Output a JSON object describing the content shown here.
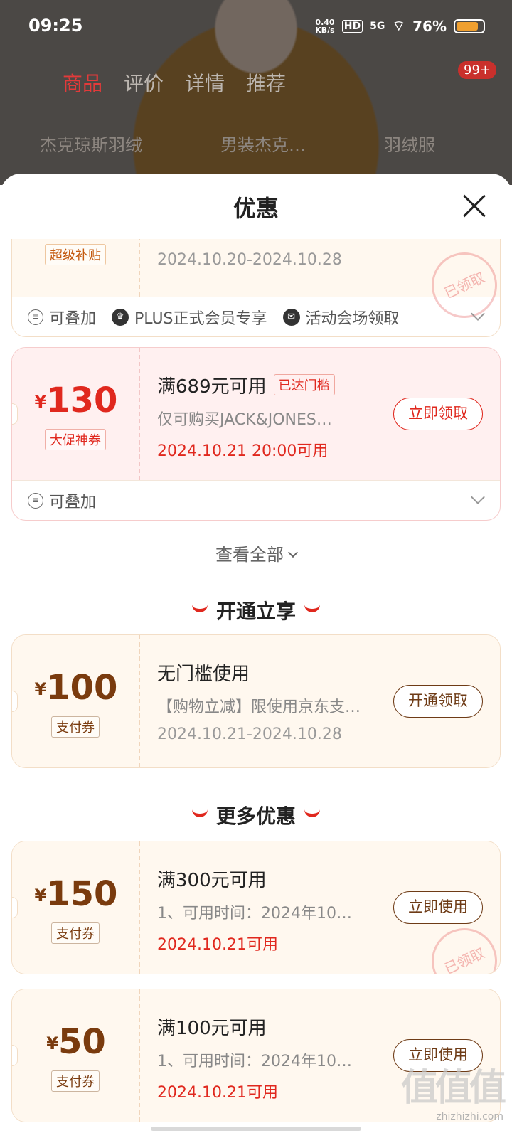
{
  "status_bar": {
    "time": "09:25",
    "net_speed_value": "0.40",
    "net_speed_unit": "KB/s",
    "hd": "HD",
    "signal": "5G",
    "battery": "76%"
  },
  "background_page": {
    "tabs": [
      "商品",
      "评价",
      "详情",
      "推荐"
    ],
    "badge": "99+",
    "search_placeholder": "杰克琼斯羽绒",
    "search_chips": [
      "男装杰克…",
      "羽绒服"
    ]
  },
  "sheet": {
    "title": "优惠",
    "cards_top": [
      {
        "tag": "超级补贴",
        "date": "2024.10.20-2024.10.28",
        "stamp": "已领取",
        "footer": {
          "items": [
            "可叠加",
            "PLUS正式会员专享",
            "活动会场领取"
          ]
        }
      },
      {
        "currency": "¥",
        "amount": "130",
        "tag": "大促神券",
        "title": "满689元可用",
        "reach_badge": "已达门槛",
        "desc": "仅可购买JACK&JONES…",
        "date": "2024.10.21 20:00可用",
        "button": "立即领取",
        "footer": {
          "items": [
            "可叠加"
          ]
        }
      }
    ],
    "see_all": "查看全部",
    "sections": [
      {
        "title": "开通立享",
        "cards": [
          {
            "currency": "¥",
            "amount": "100",
            "tag": "支付券",
            "title": "无门槛使用",
            "desc": "【购物立减】限使用京东支…",
            "date": "2024.10.21-2024.10.28",
            "button": "开通领取"
          }
        ]
      },
      {
        "title": "更多优惠",
        "cards": [
          {
            "currency": "¥",
            "amount": "150",
            "tag": "支付券",
            "title": "满300元可用",
            "desc": "1、可用时间：2024年10…",
            "date": "2024.10.21可用",
            "button": "立即使用",
            "stamp": "已领取"
          },
          {
            "currency": "¥",
            "amount": "50",
            "tag": "支付券",
            "title": "满100元可用",
            "desc": "1、可用时间：2024年10…",
            "date": "2024.10.21可用",
            "button": "立即使用"
          }
        ]
      }
    ]
  },
  "watermark": {
    "logo": "值值值",
    "url": "zhizhizhi.com"
  },
  "colors": {
    "accent_red": "#e0281e",
    "brown": "#7a3b0e",
    "card_bg": "#fff8ef",
    "card_red_bg": "#fff0f0"
  }
}
